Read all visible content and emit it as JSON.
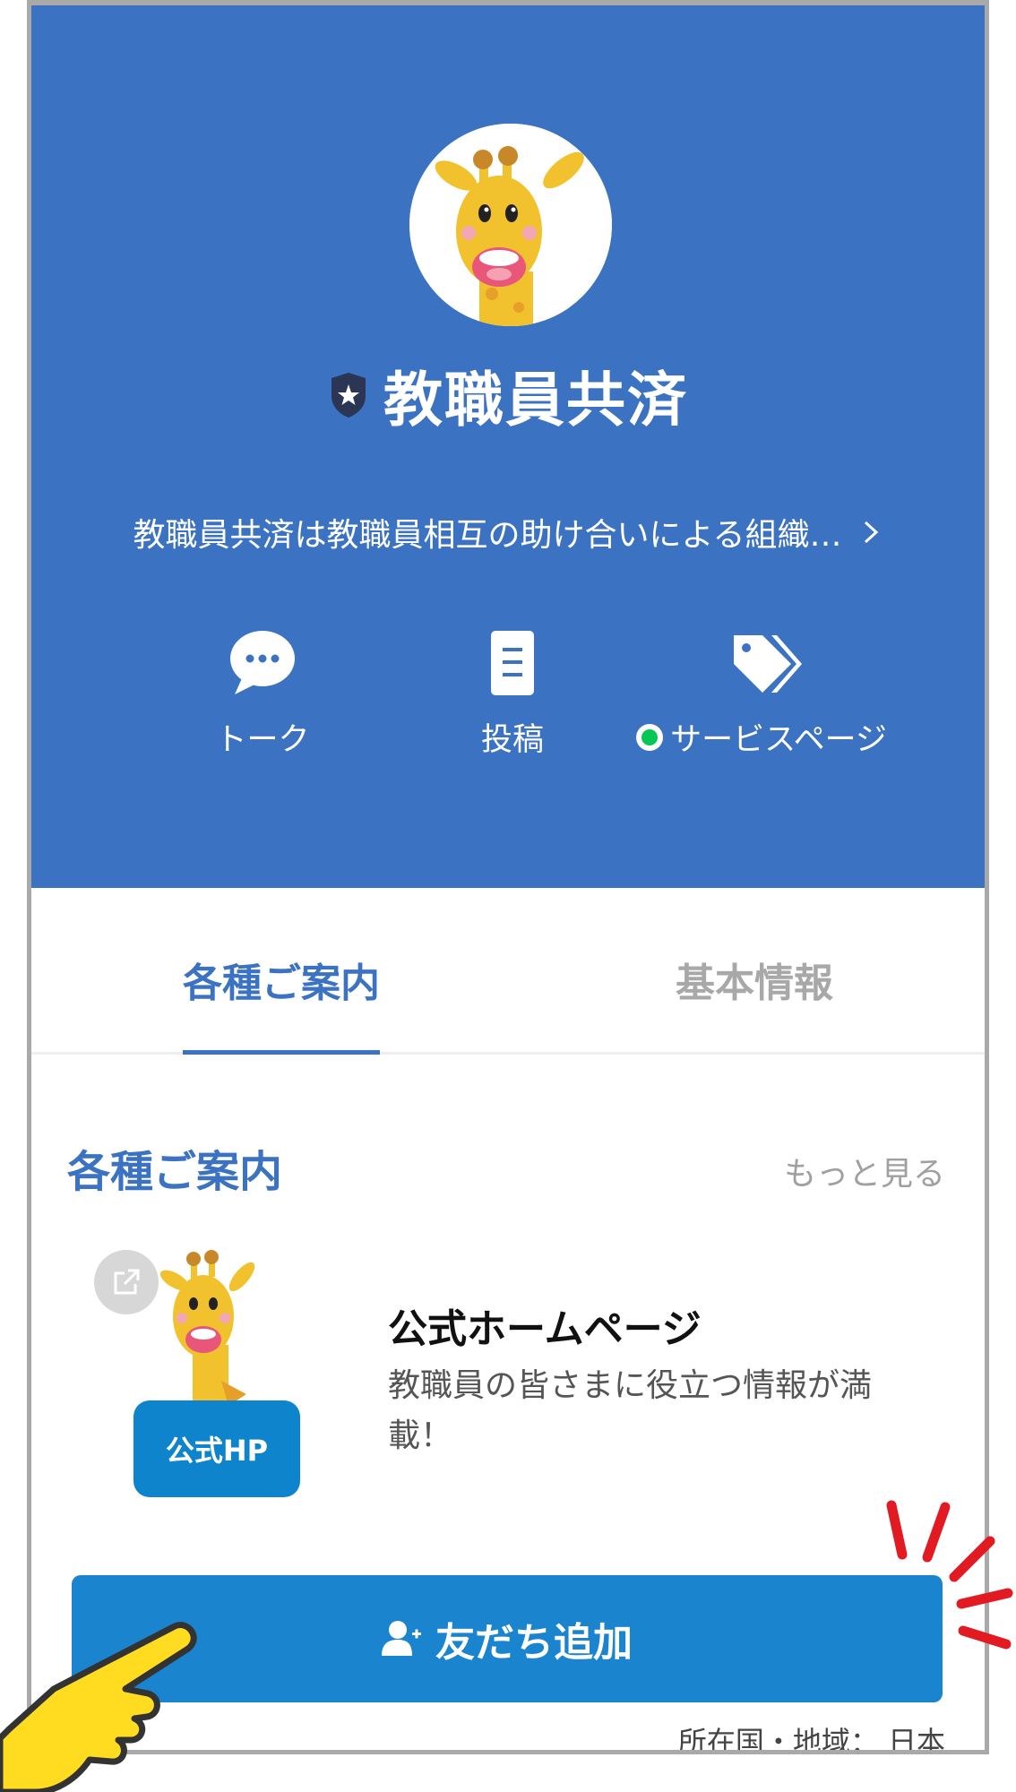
{
  "profile": {
    "name": "教職員共済",
    "description": "教職員共済は教職員相互の助け合いによる組織…"
  },
  "actions": [
    {
      "label": "トーク",
      "icon": "chat-bubble-icon"
    },
    {
      "label": "投稿",
      "icon": "post-document-icon"
    },
    {
      "label": "サービスページ",
      "icon": "tag-icon"
    }
  ],
  "tabs": [
    {
      "label": "各種ご案内",
      "active": true
    },
    {
      "label": "基本情報",
      "active": false
    }
  ],
  "section": {
    "title": "各種ご案内",
    "more": "もっと見る"
  },
  "card": {
    "thumb_label": "公式HP",
    "title": "公式ホームページ",
    "description": "教職員の皆さまに役立つ情報が満載！"
  },
  "add_friend": {
    "label": "友だち追加"
  },
  "region": "所在国・地域： 日本",
  "colors": {
    "header": "#3b72c1",
    "accent": "#3b72c1",
    "button": "#1a84cf",
    "online_dot": "#06c755"
  }
}
